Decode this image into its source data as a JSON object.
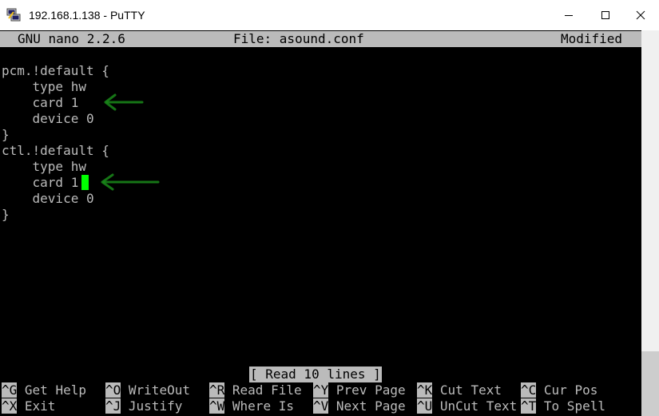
{
  "window": {
    "title": "192.168.1.138 - PuTTY",
    "icon": "putty-icon"
  },
  "nano": {
    "version": "GNU nano 2.2.6",
    "file": "File: asound.conf",
    "state": "Modified",
    "status_message": "[ Read 10 lines ]"
  },
  "file_lines": [
    "pcm.!default {",
    "    type hw",
    "    card 1",
    "    device 0",
    "}",
    "ctl.!default {",
    "    type hw",
    "    card 1",
    "    device 0",
    "}"
  ],
  "shortcuts": [
    {
      "key": "^G",
      "label": "Get Help"
    },
    {
      "key": "^O",
      "label": "WriteOut"
    },
    {
      "key": "^R",
      "label": "Read File"
    },
    {
      "key": "^Y",
      "label": "Prev Page"
    },
    {
      "key": "^K",
      "label": "Cut Text"
    },
    {
      "key": "^C",
      "label": "Cur Pos"
    },
    {
      "key": "^X",
      "label": "Exit"
    },
    {
      "key": "^J",
      "label": "Justify"
    },
    {
      "key": "^W",
      "label": "Where Is"
    },
    {
      "key": "^V",
      "label": "Next Page"
    },
    {
      "key": "^U",
      "label": "UnCut Text"
    },
    {
      "key": "^T",
      "label": "To Spell"
    }
  ],
  "colors": {
    "terminal_bg": "#000000",
    "terminal_fg": "#bbbbbb",
    "cursor": "#00ff00",
    "annotation_arrow": "#1a8a1a"
  }
}
